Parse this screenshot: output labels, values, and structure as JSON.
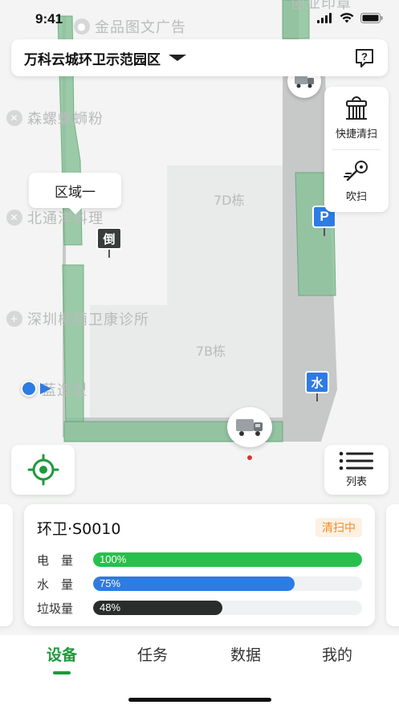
{
  "status_bar": {
    "time": "9:41"
  },
  "area": {
    "name": "万科云城环卫示范园区"
  },
  "tools": [
    {
      "label": "快捷清扫",
      "icon": "broom-sweeper-icon"
    },
    {
      "label": "吹扫",
      "icon": "blower-icon"
    }
  ],
  "map": {
    "pois": [
      {
        "label": "金品图文广告",
        "icon": "pin-icon"
      },
      {
        "label": "创业印章",
        "icon": "pin-icon"
      },
      {
        "label": "森螺螺蛳粉",
        "icon": "restaurant-icon"
      },
      {
        "label": "北通洋料理",
        "icon": "restaurant-icon"
      },
      {
        "label": "深圳柳荫卫康诊所",
        "icon": "clinic-icon"
      },
      {
        "label": "蓝造型",
        "icon": "pin-icon"
      }
    ],
    "buildings": [
      "7D栋",
      "7B栋"
    ],
    "zone_callout": "区域一",
    "markers": {
      "reverse": "倒",
      "parking": "P",
      "water": "水"
    }
  },
  "list_button": {
    "label": "列表"
  },
  "vehicle": {
    "name": "环卫·S0010",
    "status": "清扫中",
    "status_color": "#f08a2a",
    "meters": [
      {
        "label": "电　量",
        "value": 100,
        "text": "100%",
        "color": "#27c04d"
      },
      {
        "label": "水　量",
        "value": 75,
        "text": "75%",
        "color": "#2d7be5"
      },
      {
        "label": "垃圾量",
        "value": 48,
        "text": "48%",
        "color": "#2b2d2d"
      }
    ]
  },
  "tabs": [
    {
      "label": "设备",
      "active": true
    },
    {
      "label": "任务",
      "active": false
    },
    {
      "label": "数据",
      "active": false
    },
    {
      "label": "我的",
      "active": false
    }
  ],
  "colors": {
    "accent": "#1e9a3c",
    "route_fill": "#8cc39c",
    "road": "#c7c9c9"
  }
}
